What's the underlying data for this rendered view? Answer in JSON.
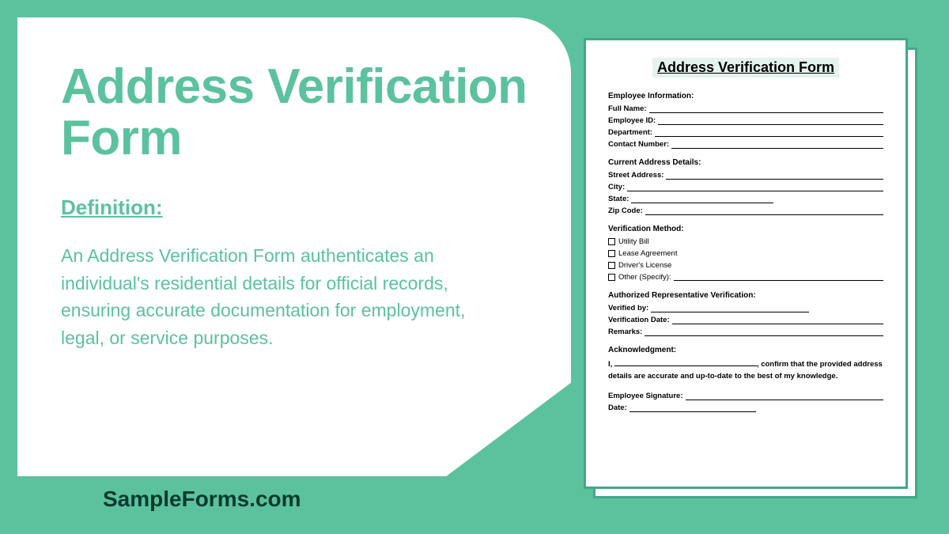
{
  "main": {
    "title": "Address Verification Form",
    "def_label": "Definition:",
    "def_text": "An Address Verification Form authenticates an individual's residential details for official records, ensuring accurate documentation for employment, legal, or service purposes."
  },
  "brand": "SampleForms.com",
  "form": {
    "title": "Address Verification Form",
    "sections": {
      "emp_info": {
        "head": "Employee Information:",
        "fields": [
          "Full Name:",
          "Employee ID:",
          "Department:",
          "Contact Number:"
        ]
      },
      "addr": {
        "head": "Current Address Details:",
        "fields": [
          "Street Address:",
          "City:",
          "State:",
          "Zip Code:"
        ]
      },
      "method": {
        "head": "Verification Method:",
        "options": [
          "Utility Bill",
          "Lease Agreement",
          "Driver's License",
          "Other (Specify):"
        ]
      },
      "auth": {
        "head": "Authorized Representative Verification:",
        "fields": [
          "Verified by:",
          "Verification Date:",
          "Remarks:"
        ]
      },
      "ack": {
        "head": "Acknowledgment:",
        "prefix": "I,",
        "suffix": ", confirm that the provided address details are accurate and up-to-date to the best of my knowledge."
      },
      "sign": {
        "fields": [
          "Employee Signature:",
          "Date:"
        ]
      }
    }
  }
}
